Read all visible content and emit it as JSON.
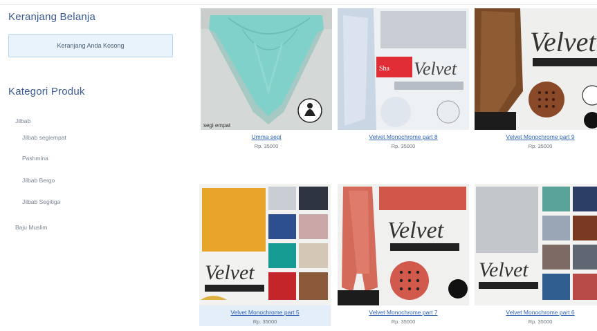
{
  "sidebar": {
    "cart_title": "Keranjang Belanja",
    "cart_empty": "Keranjang Anda Kosong",
    "category_title": "Kategori Produk",
    "categories": [
      "Jilbab",
      "Jilbab segiempat",
      "Pashmina",
      "Jilbab Bergo",
      "Jilbab Segitiga",
      "Baju Muslim"
    ]
  },
  "products": [
    {
      "name": "Umma segi",
      "price": "Rp. 35000",
      "thumb_label": "segi empat"
    },
    {
      "name": "Velvet Monochrome part 8",
      "price": "Rp. 35000",
      "thumb_label": "Velvet"
    },
    {
      "name": "Velvet Monochrome part 9",
      "price": "Rp. 35000",
      "thumb_label": "Velvet"
    },
    {
      "name": "Velvet Monochrome part 5",
      "price": "Rp. 35000",
      "thumb_label": "Velvet"
    },
    {
      "name": "Velvet Monochrome part 7",
      "price": "Rp. 35000",
      "thumb_label": "Velvet"
    },
    {
      "name": "Velvet Monochrome part 6",
      "price": "Rp. 35000",
      "thumb_label": "Velvet"
    }
  ],
  "colors": {
    "heading": "#3a5a96",
    "link": "#2d62b5",
    "cart_bg": "#e9f3fb",
    "highlight": "#e4eef8"
  }
}
